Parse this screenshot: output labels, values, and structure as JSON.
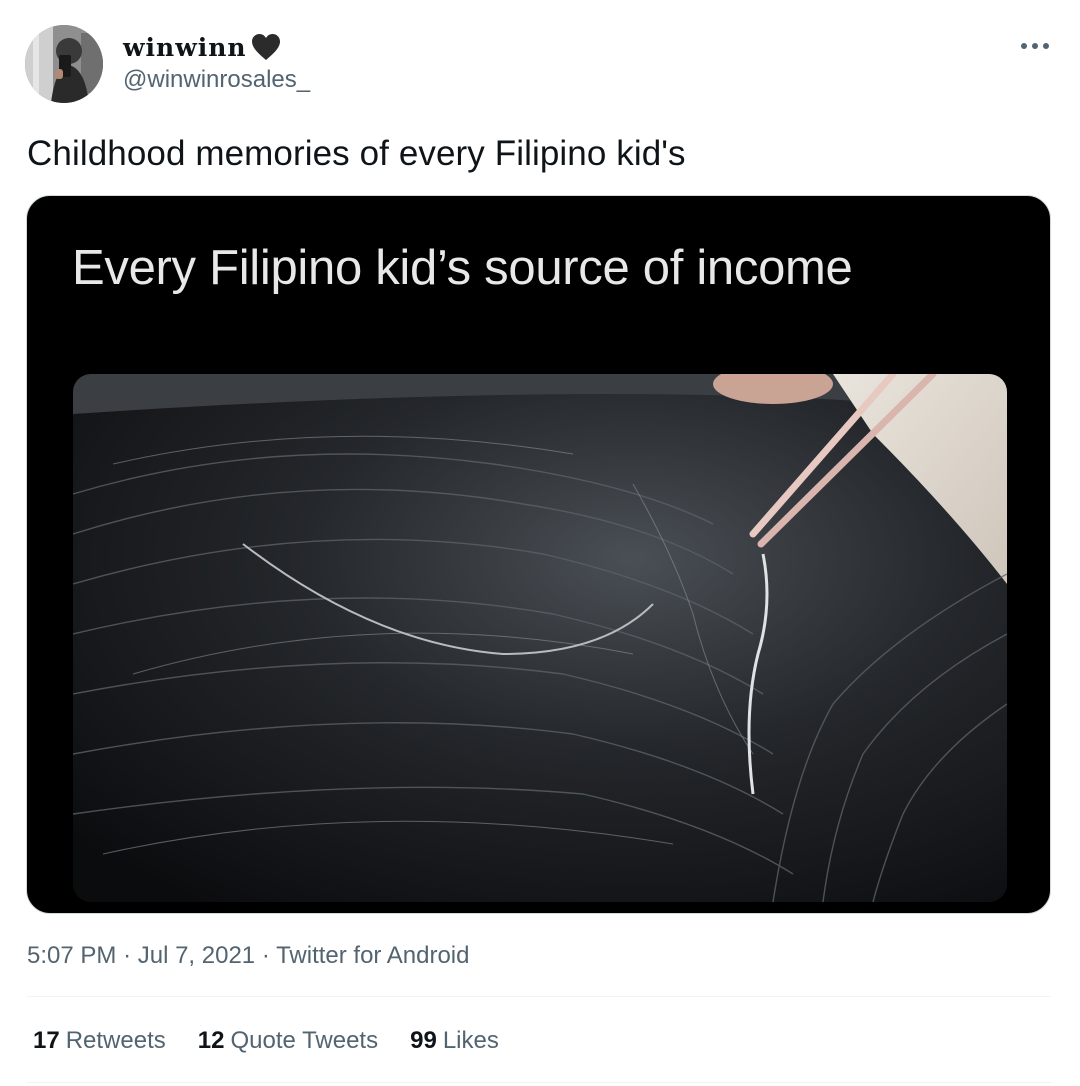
{
  "user": {
    "display_name": "winwinn",
    "handle": "@winwinrosales_"
  },
  "tweet": {
    "text": "Childhood memories of every Filipino kid's",
    "media_caption": "Every Filipino kid’s source of income",
    "time": "5:07 PM",
    "date": "Jul 7, 2021",
    "separator": "·",
    "source": "Twitter for Android"
  },
  "stats": {
    "retweets": {
      "count": "17",
      "label": "Retweets"
    },
    "quote_tweets": {
      "count": "12",
      "label": "Quote Tweets"
    },
    "likes": {
      "count": "99",
      "label": "Likes"
    }
  },
  "icons": {
    "name_emoji": "black-heart-icon",
    "more": "more-dots-icon"
  },
  "colors": {
    "text_primary": "#0f1419",
    "text_secondary": "#536471",
    "divider": "#eff3f4"
  }
}
